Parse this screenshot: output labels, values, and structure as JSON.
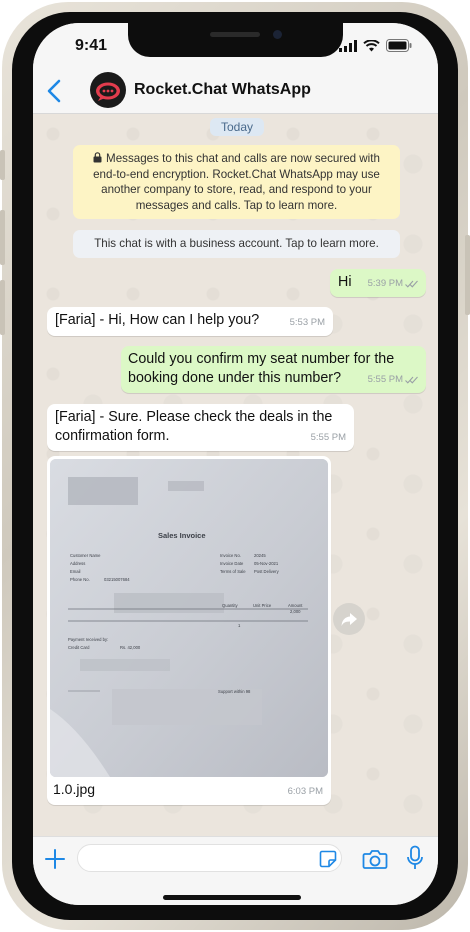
{
  "status_bar": {
    "time": "9:41"
  },
  "header": {
    "chat_name": "Rocket.Chat WhatsApp",
    "back_icon": "chevron-left-icon"
  },
  "chat": {
    "date_chip": "Today",
    "encryption_notice": "Messages to this chat and calls are now secured with end-to-end encryption. Rocket.Chat WhatsApp may use another company to store, read, and respond to your messages and calls. Tap to learn more.",
    "business_notice": "This chat is with a business account. Tap to learn more.",
    "messages": [
      {
        "direction": "outgoing",
        "text": "Hi",
        "time": "5:39 PM"
      },
      {
        "direction": "incoming",
        "text": "[Faria] - Hi, How can I help you?",
        "time": "5:53 PM"
      },
      {
        "direction": "outgoing",
        "text": "Could you confirm my seat number for the booking done under this number?",
        "time": "5:55 PM"
      },
      {
        "direction": "incoming",
        "text": "[Faria] - Sure. Please check the deals in the confirmation form.",
        "time": "5:55 PM"
      },
      {
        "direction": "incoming",
        "type": "image",
        "caption": "1.0.jpg",
        "time": "6:03 PM"
      }
    ],
    "invoice": {
      "title": "Sales Invoice",
      "labels": [
        "Customer Name",
        "Address",
        "Email",
        "Phone No."
      ],
      "phone": "03215007684",
      "invoice_labels": [
        "Invoice No.",
        "Invoice Date",
        "Terms of Sale"
      ],
      "invoice_no": "20245",
      "invoice_date": "05-Nov-2021",
      "terms": "Post Delivery",
      "columns": [
        "Quantity",
        "Unit Price",
        "Amount"
      ],
      "quantity": "1",
      "amount": "2,000",
      "payment_label": "Payment received by:",
      "payment_method": "Credit Card",
      "payment_amount": "Rs. 42,000",
      "support": "Support within 98"
    }
  },
  "composer": {
    "placeholder": ""
  },
  "colors": {
    "incoming_bubble": "#ffffff",
    "outgoing_bubble": "#dcf8c6",
    "accent": "#1e88e5",
    "notice": "#fdf4c5"
  }
}
